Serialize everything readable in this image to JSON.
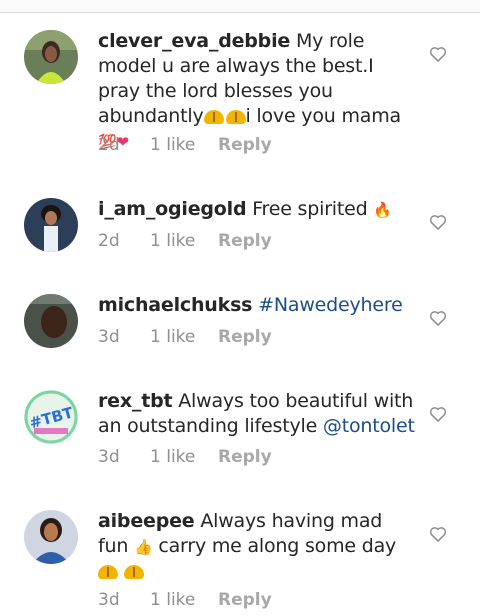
{
  "comments": [
    {
      "username": "clever_eva_debbie",
      "text_a": "My role model u are always the best.I pray the lord blesses you abundantly",
      "text_b": "i love you mama",
      "emoji_hundred": "💯",
      "emoji_heart": "❤",
      "time": "2d",
      "likes": "1 like",
      "reply": "Reply"
    },
    {
      "username": "i_am_ogiegold",
      "text": "Free spirited",
      "emoji_fire": "🔥",
      "time": "2d",
      "likes": "1 like",
      "reply": "Reply"
    },
    {
      "username": "michaelchukss",
      "hashtag": "#Nawedeyhere",
      "time": "3d",
      "likes": "1 like",
      "reply": "Reply"
    },
    {
      "username": "rex_tbt",
      "text": "Always too beautiful with an outstanding lifestyle",
      "mention": "@tontolet",
      "time": "3d",
      "likes": "1 like",
      "reply": "Reply"
    },
    {
      "username": "aibeepee",
      "text_a": "Always having mad fun",
      "emoji_thumb": "👍",
      "text_b": "carry me along some day",
      "time": "3d",
      "likes": "1 like",
      "reply": "Reply"
    }
  ],
  "avatars": {
    "rex_tbt_text": "#TBT"
  },
  "colors": {
    "link": "#1b4d8c",
    "meta": "#8e8e8e",
    "username": "#262626"
  },
  "icons": {
    "like": "heart-outline-icon",
    "pray": "folded-hands-emoji"
  }
}
